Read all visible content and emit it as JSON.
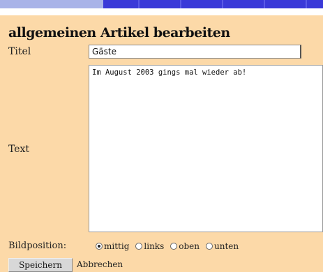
{
  "colors": {
    "background": "#fcd9a8",
    "tab_bar": "#3a39d8",
    "tab_bar_left": "#a9b3e8"
  },
  "form": {
    "heading": "allgemeinen Artikel bearbeiten",
    "title_label": "Titel",
    "title_value": "Gäste",
    "text_label": "Text",
    "text_value": "Im August 2003 gings mal wieder ab!",
    "image_position_label": "Bildposition:",
    "image_position_options": [
      "mittig",
      "links",
      "oben",
      "unten"
    ],
    "image_position_selected": "mittig",
    "save_label": "Speichern",
    "cancel_label": "Abbrechen"
  }
}
